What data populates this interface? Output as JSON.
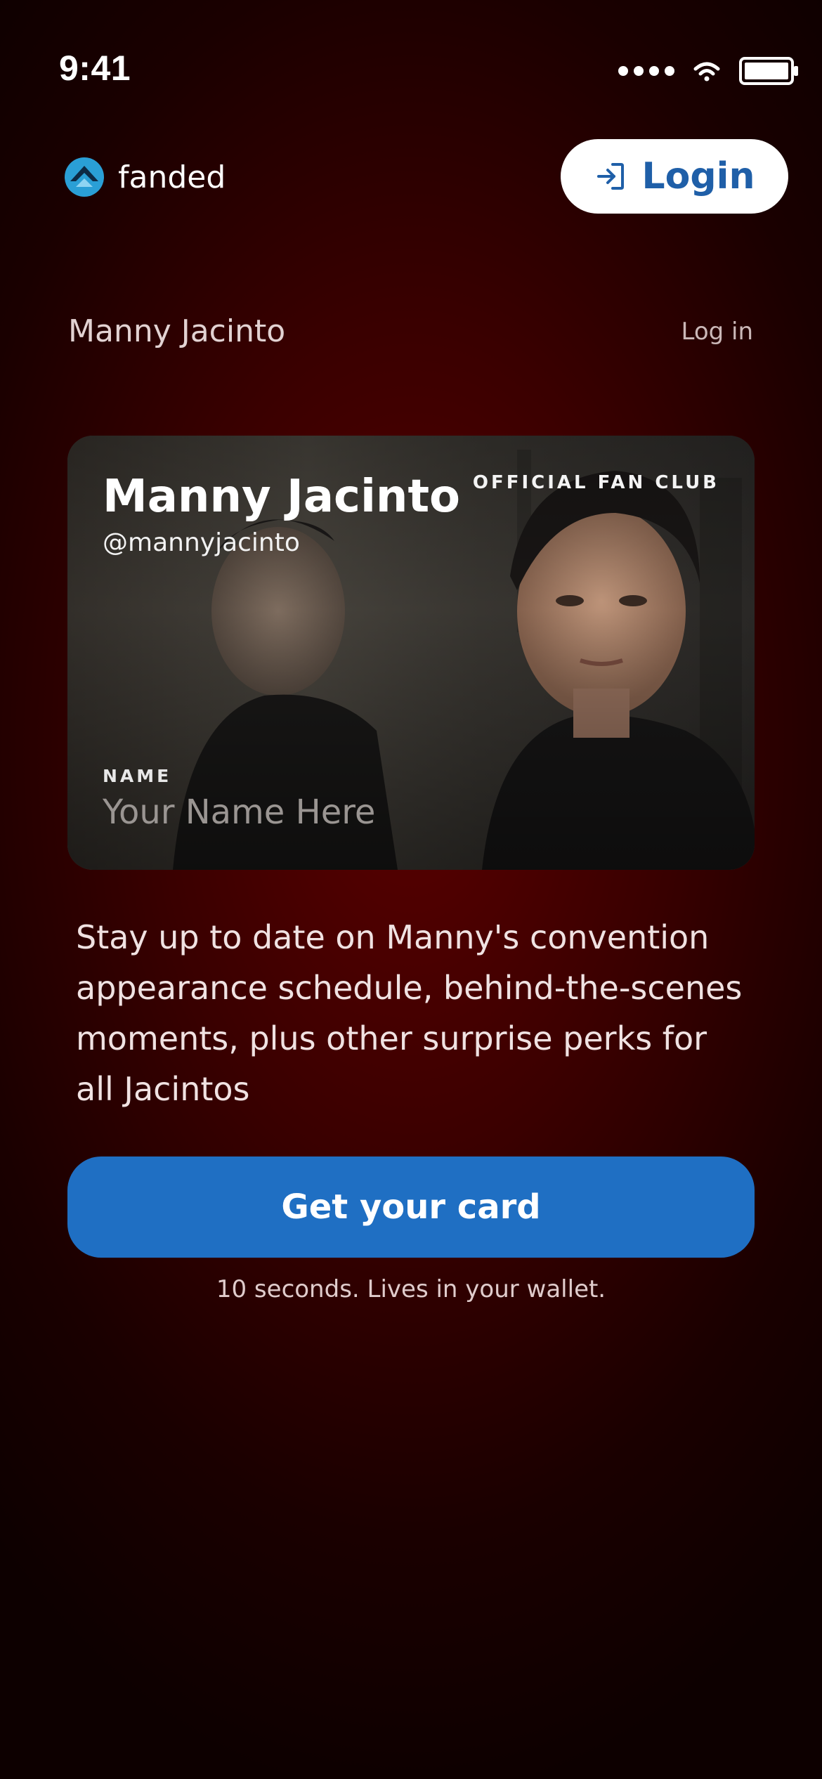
{
  "status_bar": {
    "time": "9:41"
  },
  "header": {
    "brand_name": "fanded",
    "login_button_label": "Login"
  },
  "section": {
    "artist_name": "Manny Jacinto",
    "login_link": "Log in"
  },
  "card": {
    "title": "Manny Jacinto",
    "handle": "@mannyjacinto",
    "club_label": "OFFICIAL FAN CLUB",
    "name_label": "NAME",
    "name_placeholder": "Your Name Here"
  },
  "description": "Stay up to date on Manny's convention appearance schedule, behind-the-scenes moments, plus other surprise perks for all Jacintos",
  "cta": {
    "button_label": "Get your card",
    "subtext": "10 seconds. Lives in your wallet."
  },
  "colors": {
    "accent_blue": "#1f6fc3",
    "login_text": "#1f5fa8",
    "background": "#3a0000"
  },
  "icons": {
    "brand_logo": "fanded-logo-icon",
    "login": "login-arrow-icon",
    "signal": "signal-dots-icon",
    "wifi": "wifi-icon",
    "battery": "battery-icon"
  }
}
